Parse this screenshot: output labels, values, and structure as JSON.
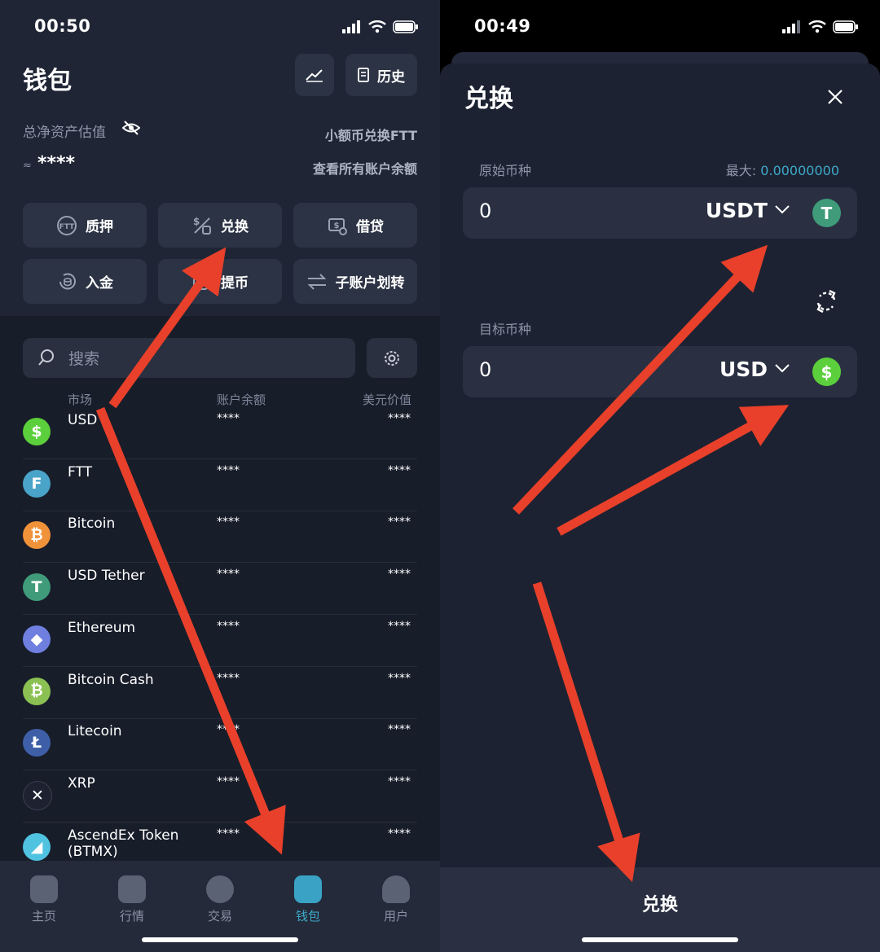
{
  "left": {
    "status": {
      "time": "00:50"
    },
    "title": "钱包",
    "history_label": "历史",
    "net_assets_label": "总净资产估值",
    "small_convert_link": "小额币兑换FTT",
    "approx_symbol": "≈",
    "balance_masked": "****",
    "view_all_link": "查看所有账户余额",
    "actions": [
      "质押",
      "兑换",
      "借贷",
      "入金",
      "提币",
      "子账户划转"
    ],
    "search_placeholder": "搜索",
    "columns": {
      "market": "市场",
      "balance": "账户余额",
      "usd_value": "美元价值"
    },
    "rows": [
      {
        "name": "USD",
        "balance": "****",
        "usd": "****",
        "icon": "usd-coin-icon",
        "color": "#5ccf3c"
      },
      {
        "name": "FTT",
        "balance": "****",
        "usd": "****",
        "icon": "ftt-coin-icon",
        "color": "#4aa3c8"
      },
      {
        "name": "Bitcoin",
        "balance": "****",
        "usd": "****",
        "icon": "bitcoin-icon",
        "color": "#f0923a"
      },
      {
        "name": "USD Tether",
        "balance": "****",
        "usd": "****",
        "icon": "tether-icon",
        "color": "#3f9b7a"
      },
      {
        "name": "Ethereum",
        "balance": "****",
        "usd": "****",
        "icon": "ethereum-icon",
        "color": "#6e7fe0"
      },
      {
        "name": "Bitcoin Cash",
        "balance": "****",
        "usd": "****",
        "icon": "bitcoin-cash-icon",
        "color": "#8ac152"
      },
      {
        "name": "Litecoin",
        "balance": "****",
        "usd": "****",
        "icon": "litecoin-icon",
        "color": "#3e5fa8"
      },
      {
        "name": "XRP",
        "balance": "****",
        "usd": "****",
        "icon": "xrp-icon",
        "color": "#1d2130"
      },
      {
        "name": "AscendEx Token (BTMX)",
        "balance": "****",
        "usd": "****",
        "icon": "ascendex-icon",
        "color": "#4fc3e0"
      }
    ],
    "tabs": [
      {
        "label": "主页",
        "active": false
      },
      {
        "label": "行情",
        "active": false
      },
      {
        "label": "交易",
        "active": false
      },
      {
        "label": "钱包",
        "active": true
      },
      {
        "label": "用户",
        "active": false
      }
    ]
  },
  "right": {
    "status": {
      "time": "00:49"
    },
    "title": "兑换",
    "source_label": "原始币种",
    "max_label": "最大:",
    "max_value": "0.00000000",
    "source_amount": "0",
    "source_currency": "USDT",
    "target_label": "目标币种",
    "target_amount": "0",
    "target_currency": "USD",
    "convert_button": "兑换"
  },
  "colors": {
    "accent": "#3da9c9",
    "arrow": "#e8402a",
    "usd_green": "#5ccf3c",
    "tether_green": "#3f9b7a"
  }
}
